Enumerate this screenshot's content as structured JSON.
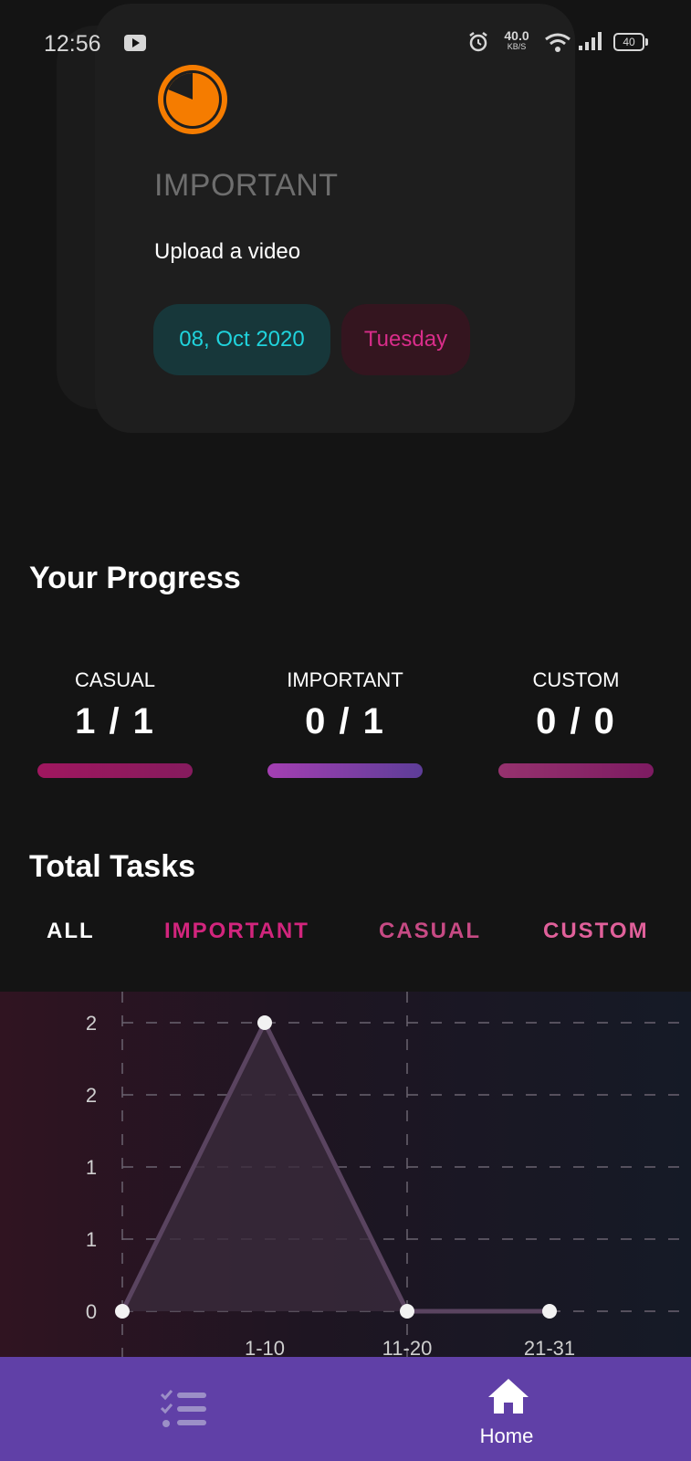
{
  "status_bar": {
    "time": "12:56",
    "net_speed_value": "40.0",
    "net_speed_unit": "KB/S",
    "battery": "40",
    "icons": [
      "youtube-icon",
      "alarm-icon",
      "wifi-icon",
      "signal-icon",
      "battery-icon"
    ]
  },
  "task_card": {
    "icon": "pie-timer-icon",
    "category": "IMPORTANT",
    "task": "Upload a video",
    "date": "08, Oct 2020",
    "day": "Tuesday",
    "colors": {
      "icon": "#f57c00",
      "date": "#20d3dc",
      "day": "#d92d8a"
    }
  },
  "progress": {
    "title": "Your Progress",
    "items": [
      {
        "label": "CASUAL",
        "value": "1 / 1",
        "gradient": [
          "#a0175f",
          "#851b5e"
        ]
      },
      {
        "label": "IMPORTANT",
        "value": "0 / 1",
        "gradient": [
          "#a43fb2",
          "#5d3d98"
        ]
      },
      {
        "label": "CUSTOM",
        "value": "0 / 0",
        "gradient": [
          "#96326e",
          "#7d1b62"
        ]
      }
    ]
  },
  "total_tasks": {
    "title": "Total Tasks",
    "tabs": [
      {
        "label": "ALL",
        "color": "#ffffff"
      },
      {
        "label": "IMPORTANT",
        "color": "#d2257d"
      },
      {
        "label": "CASUAL",
        "color": "#c74a84"
      },
      {
        "label": "CUSTOM",
        "color": "#e0609a"
      }
    ]
  },
  "chart_data": {
    "type": "area",
    "x": [
      "",
      "1-10",
      "11-20",
      "21-31"
    ],
    "values": [
      0,
      2,
      0,
      0
    ],
    "y_tick_labels": [
      "0",
      "1",
      "1",
      "2",
      "2"
    ],
    "ylim": [
      0,
      2
    ],
    "grid": true,
    "colors": {
      "line": "#5a4460",
      "fill": "#3a2a3c",
      "point": "#f2f2f2"
    }
  },
  "bottom_nav": {
    "items": [
      {
        "name": "tasks",
        "icon": "checklist-icon",
        "label": ""
      },
      {
        "name": "home",
        "icon": "home-icon",
        "label": "Home"
      }
    ],
    "background": "#6040a7"
  }
}
